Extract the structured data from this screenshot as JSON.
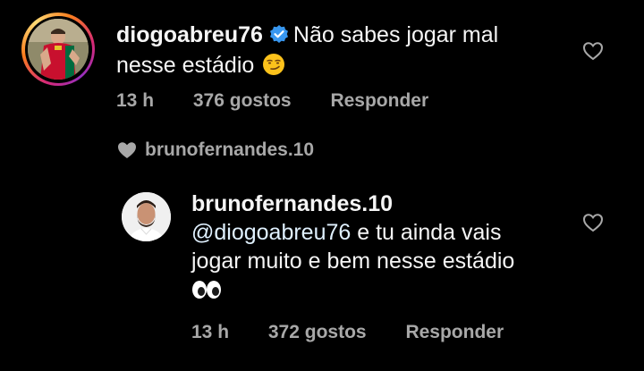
{
  "main_comment": {
    "username": "diogoabreu76",
    "text_line1": "Não sabes jogar mal",
    "text_line2": "nesse estádio",
    "emoji": "smirking-face",
    "time": "13 h",
    "likes": "376 gostos",
    "reply_label": "Responder"
  },
  "liked_by": {
    "username": "brunofernandes.10"
  },
  "reply": {
    "username": "brunofernandes.10",
    "mention": "@diogoabreu76",
    "text_line1_rest": " e tu ainda vais",
    "text_line2": "jogar muito e bem nesse estádio",
    "emoji": "eyes",
    "time": "13 h",
    "likes": "372 gostos",
    "reply_label": "Responder"
  },
  "colors": {
    "background": "#000000",
    "text": "#f5f5f5",
    "muted": "#a8a8a8",
    "verified": "#3897f0",
    "mention": "#e0f1ff"
  }
}
